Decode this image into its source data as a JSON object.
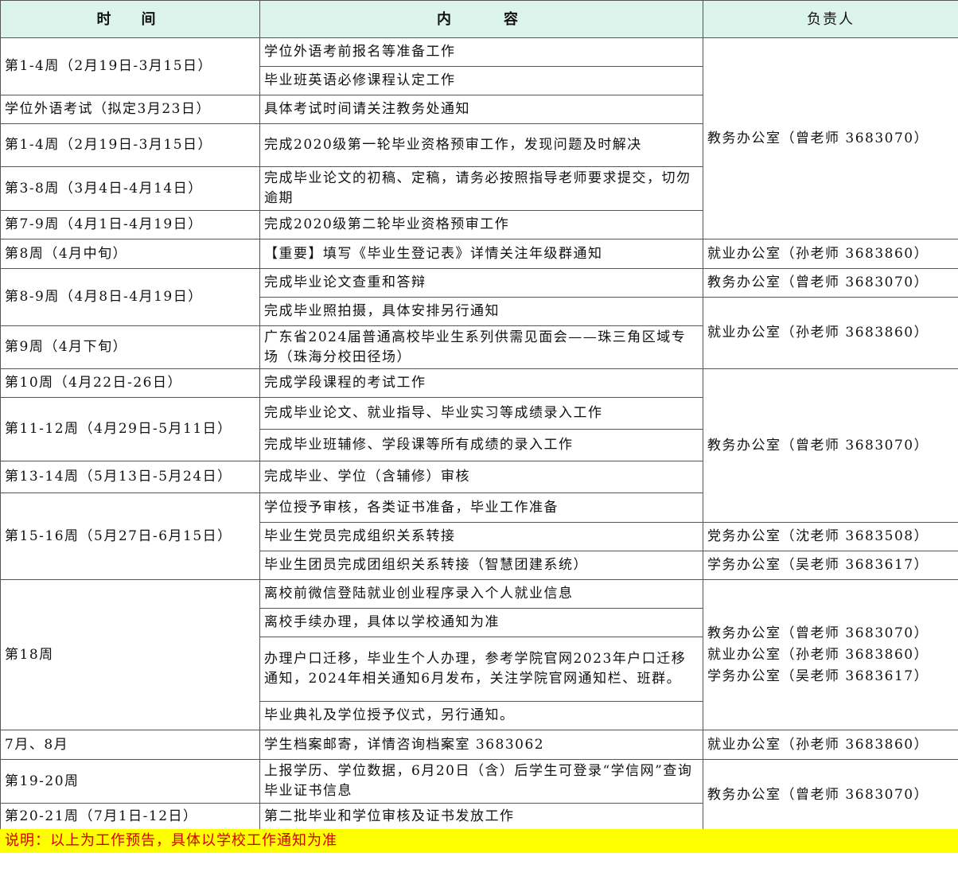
{
  "headers": {
    "time": "时　间",
    "content": "内　　容",
    "owner": "负责人"
  },
  "times": {
    "t1": "第1-4周（2月19日-3月15日）",
    "t2": "学位外语考试（拟定3月23日）",
    "t3": "第1-4周（2月19日-3月15日）",
    "t4": "第3-8周（3月4日-4月14日）",
    "t5": "第7-9周（4月1日-4月19日）",
    "t6": "第8周（4月中旬）",
    "t7": "第8-9周（4月8日-4月19日）",
    "t8": "第9周（4月下旬）",
    "t9": "第10周（4月22日-26日）",
    "t10": "第11-12周（4月29日-5月11日）",
    "t11": "第13-14周（5月13日-5月24日）",
    "t12": "第15-16周（5月27日-6月15日）",
    "t13": "第18周",
    "t14": "7月、8月",
    "t15": "第19-20周",
    "t16": "第20-21周（7月1日-12日）"
  },
  "contents": [
    "学位外语考前报名等准备工作",
    "毕业班英语必修课程认定工作",
    "具体考试时间请关注教务处通知",
    "完成2020级第一轮毕业资格预审工作，发现问题及时解决",
    "完成毕业论文的初稿、定稿，请务必按照指导老师要求提交，切勿逾期",
    "完成2020级第二轮毕业资格预审工作",
    "【重要】填写《毕业生登记表》详情关注年级群通知",
    "完成毕业论文查重和答辩",
    "完成毕业照拍摄，具体安排另行通知",
    "广东省2024届普通高校毕业生系列供需见面会——珠三角区域专场（珠海分校田径场）",
    "完成学段课程的考试工作",
    "完成毕业论文、就业指导、毕业实习等成绩录入工作",
    "完成毕业班辅修、学段课等所有成绩的录入工作",
    "完成毕业、学位（含辅修）审核",
    "学位授予审核，各类证书准备，毕业工作准备",
    "毕业生党员完成组织关系转接",
    "毕业生团员完成团组织关系转接（智慧团建系统）",
    "离校前微信登陆就业创业程序录入个人就业信息",
    "离校手续办理，具体以学校通知为准",
    "办理户口迁移，毕业生个人办理，参考学院官网2023年户口迁移通知，2024年相关通知6月发布，关注学院官网通知栏、班群。",
    "毕业典礼及学位授予仪式，另行通知。",
    "学生档案邮寄，详情咨询档案室 3683062",
    "上报学历、学位数据，6月20日（含）后学生可登录“学信网”查询毕业证书信息",
    "第二批毕业和学位审核及证书发放工作"
  ],
  "owners": {
    "o1": "教务办公室（曾老师 3683070）",
    "o2": "就业办公室（孙老师 3683860）",
    "o3": "教务办公室（曾老师 3683070）",
    "o4": "就业办公室（孙老师 3683860）",
    "o5": "教务办公室（曾老师 3683070）",
    "o6": "党务办公室（沈老师 3683508）",
    "o7": "学务办公室（吴老师 3683617）",
    "o8a": "教务办公室（曾老师 3683070）",
    "o8b": "就业办公室（孙老师 3683860）",
    "o8c": "学务办公室（吴老师 3683617）",
    "o9": "就业办公室（孙老师 3683860）",
    "o10": "教务办公室（曾老师 3683070）"
  },
  "note": "说明：以上为工作预告，具体以学校工作通知为准"
}
